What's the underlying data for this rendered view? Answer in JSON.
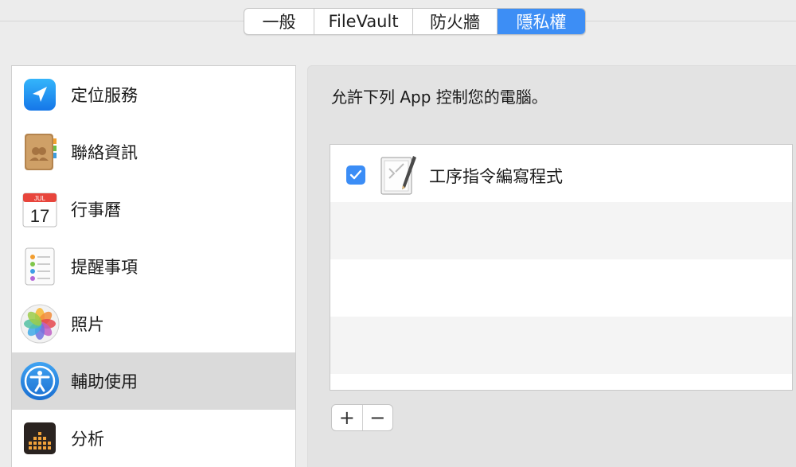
{
  "tabs": [
    {
      "label": "一般",
      "active": false
    },
    {
      "label": "FileVault",
      "active": false
    },
    {
      "label": "防火牆",
      "active": false
    },
    {
      "label": "隱私權",
      "active": true
    }
  ],
  "sidebar": {
    "items": [
      {
        "label": "定位服務",
        "icon": "location-arrow-icon",
        "selected": false
      },
      {
        "label": "聯絡資訊",
        "icon": "contacts-book-icon",
        "selected": false
      },
      {
        "label": "行事曆",
        "icon": "calendar-icon",
        "selected": false,
        "month": "JUL",
        "day": "17"
      },
      {
        "label": "提醒事項",
        "icon": "reminders-icon",
        "selected": false
      },
      {
        "label": "照片",
        "icon": "photos-icon",
        "selected": false
      },
      {
        "label": "輔助使用",
        "icon": "accessibility-icon",
        "selected": true
      },
      {
        "label": "分析",
        "icon": "analytics-icon",
        "selected": false
      }
    ]
  },
  "main": {
    "title": "允許下列 App 控制您的電腦。",
    "apps": [
      {
        "name": "工序指令編寫程式",
        "checked": true,
        "icon": "script-editor-icon"
      }
    ],
    "add_label": "+",
    "remove_label": "−"
  },
  "colors": {
    "accent": "#3d8ef5",
    "window_bg": "#ececec",
    "selected_row": "#dadada"
  }
}
